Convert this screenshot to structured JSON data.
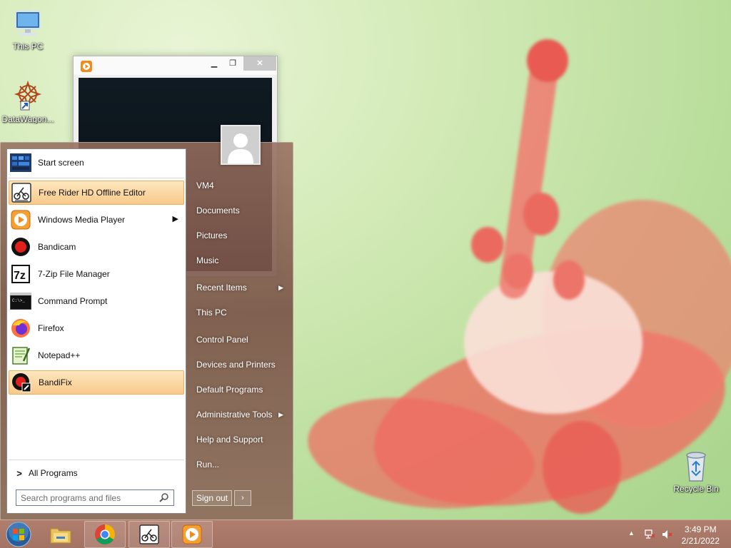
{
  "desktop": {
    "icons": [
      {
        "label": "This PC",
        "icon": "computer-icon"
      },
      {
        "label": "DataWagon...",
        "icon": "datawagon-shortcut-icon"
      },
      {
        "label": "Recycle Bin",
        "icon": "recycle-bin-icon"
      }
    ]
  },
  "start_menu": {
    "programs": [
      {
        "label": "Start screen",
        "icon": "start-screen-icon"
      },
      {
        "label": "Free Rider HD Offline Editor",
        "icon": "free-rider-icon",
        "highlighted": true
      },
      {
        "label": "Windows Media Player",
        "icon": "windows-media-player-icon",
        "has_submenu": true
      },
      {
        "label": "Bandicam",
        "icon": "bandicam-icon"
      },
      {
        "label": "7-Zip File Manager",
        "icon": "7zip-icon"
      },
      {
        "label": "Command Prompt",
        "icon": "command-prompt-icon"
      },
      {
        "label": "Firefox",
        "icon": "firefox-icon"
      },
      {
        "label": "Notepad++",
        "icon": "notepadpp-icon"
      },
      {
        "label": "BandiFix",
        "icon": "bandifix-icon",
        "highlighted": true
      }
    ],
    "all_programs": "All Programs",
    "search_placeholder": "Search programs and files",
    "user_name": "VM4",
    "right_items": [
      {
        "label": "Documents"
      },
      {
        "label": "Pictures"
      },
      {
        "label": "Music"
      },
      {
        "label": "Recent Items",
        "has_submenu": true
      },
      {
        "label": "This PC"
      },
      {
        "label": "Control Panel"
      },
      {
        "label": "Devices and Printers"
      },
      {
        "label": "Default Programs"
      },
      {
        "label": "Administrative Tools",
        "has_submenu": true
      },
      {
        "label": "Help and Support"
      },
      {
        "label": "Run..."
      }
    ],
    "sign_out": "Sign out",
    "sign_out_arrow": "›"
  },
  "taskbar": {
    "pinned": [
      "file-explorer-icon",
      "chrome-icon",
      "free-rider-icon",
      "windows-media-player-icon"
    ],
    "time": "3:49 PM",
    "date": "2/21/2022",
    "tray_expand": "▲"
  },
  "colors": {
    "highlight": "#f9c98a",
    "start_menu_tint": "#8a6052",
    "taskbar": "#a86c5f"
  }
}
